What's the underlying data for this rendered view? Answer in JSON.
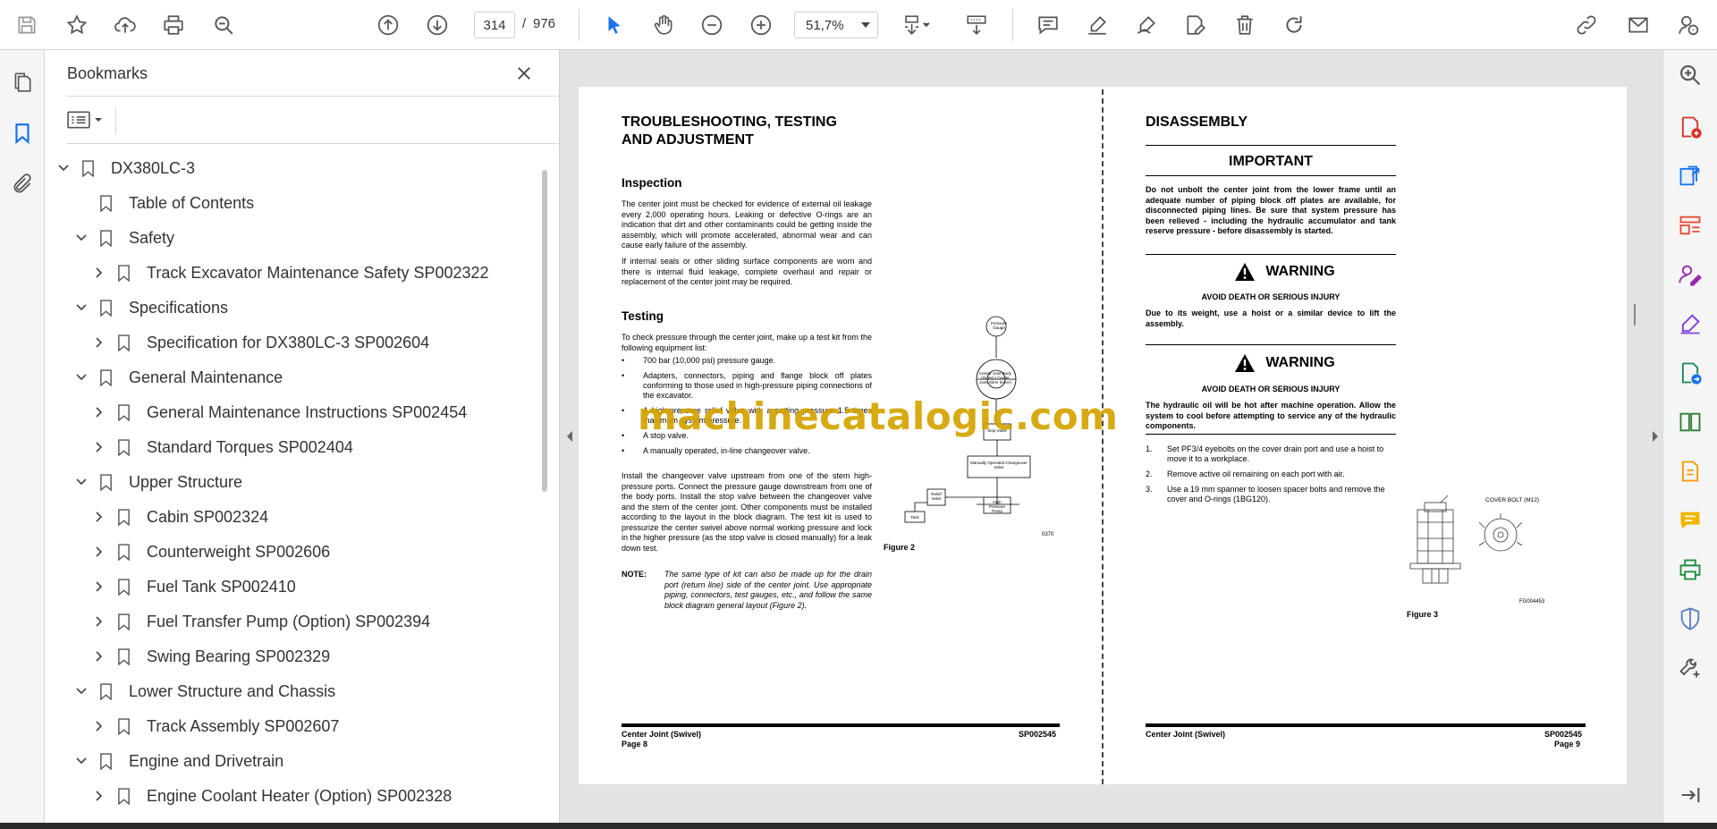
{
  "toolbar": {
    "page_current": "314",
    "page_separator": "/",
    "page_total": "976",
    "zoom": "51,7%"
  },
  "bookmarks": {
    "title": "Bookmarks",
    "items": [
      {
        "label": "DX380LC-3",
        "level": 0,
        "expanded": true
      },
      {
        "label": "Table of Contents",
        "level": 1,
        "leaf": true
      },
      {
        "label": "Safety",
        "level": 1,
        "expanded": true
      },
      {
        "label": "Track Excavator Maintenance Safety SP002322",
        "level": 2,
        "expanded": false
      },
      {
        "label": "Specifications",
        "level": 1,
        "expanded": true
      },
      {
        "label": "Specification for DX380LC-3 SP002604",
        "level": 2,
        "expanded": false
      },
      {
        "label": "General Maintenance",
        "level": 1,
        "expanded": true
      },
      {
        "label": "General Maintenance Instructions SP002454",
        "level": 2,
        "expanded": false
      },
      {
        "label": "Standard Torques SP002404",
        "level": 2,
        "expanded": false
      },
      {
        "label": "Upper Structure",
        "level": 1,
        "expanded": true
      },
      {
        "label": "Cabin SP002324",
        "level": 2,
        "expanded": false
      },
      {
        "label": "Counterweight SP002606",
        "level": 2,
        "expanded": false
      },
      {
        "label": "Fuel Tank SP002410",
        "level": 2,
        "expanded": false
      },
      {
        "label": "Fuel Transfer Pump (Option) SP002394",
        "level": 2,
        "expanded": false
      },
      {
        "label": "Swing Bearing SP002329",
        "level": 2,
        "expanded": false
      },
      {
        "label": "Lower Structure and Chassis",
        "level": 1,
        "expanded": true
      },
      {
        "label": "Track Assembly SP002607",
        "level": 2,
        "expanded": false
      },
      {
        "label": "Engine and Drivetrain",
        "level": 1,
        "expanded": true
      },
      {
        "label": "Engine Coolant Heater (Option) SP002328",
        "level": 2,
        "expanded": false
      }
    ]
  },
  "document": {
    "watermark": "machinecatalogic.com",
    "left_page": {
      "title_line1": "TROUBLESHOOTING, TESTING",
      "title_line2": "AND ADJUSTMENT",
      "inspection_heading": "Inspection",
      "inspection_p1": "The center joint must be checked for evidence of external oil leakage every 2,000 operating hours. Leaking or defective O-rings are an indication that dirt and other contaminants could be getting inside the assembly, which will promote accelerated, abnormal wear and can cause early failure of the assembly.",
      "inspection_p2": "If internal seals or other sliding surface components are worn and there is internal fluid leakage, complete overhaul and repair or replacement of the center joint may be required.",
      "testing_heading": "Testing",
      "testing_intro": "To check pressure through the center joint, make up a test kit from the following equipment list:",
      "bullets": [
        "700 bar (10,000 psi) pressure gauge.",
        "Adapters, connectors, piping and flange block off plates conforming to those used in high-pressure piping connections of the excavator.",
        "A high-pressure relief valve with a setting pressure 1.5 times maximum system pressure.",
        "A stop valve.",
        "A manually operated, in-line changeover valve."
      ],
      "testing_body": "Install the changeover valve upstream from one of the stem high-pressure ports. Connect the pressure gauge downstream from one of the body ports. Install the stop valve between the changeover valve and the stem of the center joint. Other components must be installed according to the layout in the block diagram. The test kit is used to pressurize the center swivel above normal working pressure and lock in the higher pressure (as the stop valve is closed manually) for a leak down test.",
      "note_label": "NOTE:",
      "note_text": "The same type of kit can also be made up for the drain port (return line) side of the center joint. Use appropriate piping, connectors, test gauges, etc., and follow the same block diagram general layout (Figure 2).",
      "figure_caption": "Figure 2",
      "figure_code": "0370",
      "diagram_labels": {
        "gauge": "Pressure Gauge",
        "joint": "Center Joint Body (Outer) / Center Joint Stem (Inner)",
        "stop": "Stop Valve",
        "changeover": "Manually Operated Changeover Valve",
        "relief": "Relief Valve",
        "tank": "Tank",
        "pump": "High Pressure Pump"
      },
      "footer_left": "Center Joint (Swivel)",
      "footer_page": "Page 8",
      "footer_code": "SP002545"
    },
    "right_page": {
      "title": "DISASSEMBLY",
      "important_heading": "IMPORTANT",
      "important_text": "Do not unbolt the center joint from the lower frame until an adequate number of piping block off plates are available, for disconnected piping lines. Be sure that system pressure has been relieved - including the hydraulic accumulator and tank reserve pressure - before disassembly is started.",
      "warning1_heading": "WARNING",
      "warning1_sub": "AVOID DEATH OR SERIOUS INJURY",
      "warning1_text": "Due to its weight, use a hoist or a similar device to lift the assembly.",
      "warning2_heading": "WARNING",
      "warning2_sub": "AVOID DEATH OR SERIOUS INJURY",
      "warning2_text": "The hydraulic oil will be hot after machine operation. Allow the system to cool before attempting to service any of the hydraulic components.",
      "steps": [
        {
          "n": "1.",
          "text": "Set PF3/4 eyebolts on the cover drain port and use a hoist to move it to a workplace."
        },
        {
          "n": "2.",
          "text": "Remove active oil remaining on each port with air."
        },
        {
          "n": "3.",
          "text": "Use a 19 mm spanner to loosen spacer bolts and remove the cover and O-rings (1BG120)."
        }
      ],
      "figure_label": "COVER BOLT (M12)",
      "figure_code": "FG004453",
      "figure_caption": "Figure 3",
      "footer_left": "Center Joint (Swivel)",
      "footer_page": "Page 9",
      "footer_code": "SP002545"
    }
  },
  "colors": {
    "accent_blue": "#1a73e8",
    "right_rail_icons": [
      "#d93025",
      "#1a73e8",
      "#e94b35",
      "#9b27b0",
      "#7b3fe4",
      "#1a8754",
      "#2e7d32",
      "#f29900",
      "#f2b600",
      "#1e8e3e",
      "#5b7fc7",
      "#555555"
    ]
  }
}
